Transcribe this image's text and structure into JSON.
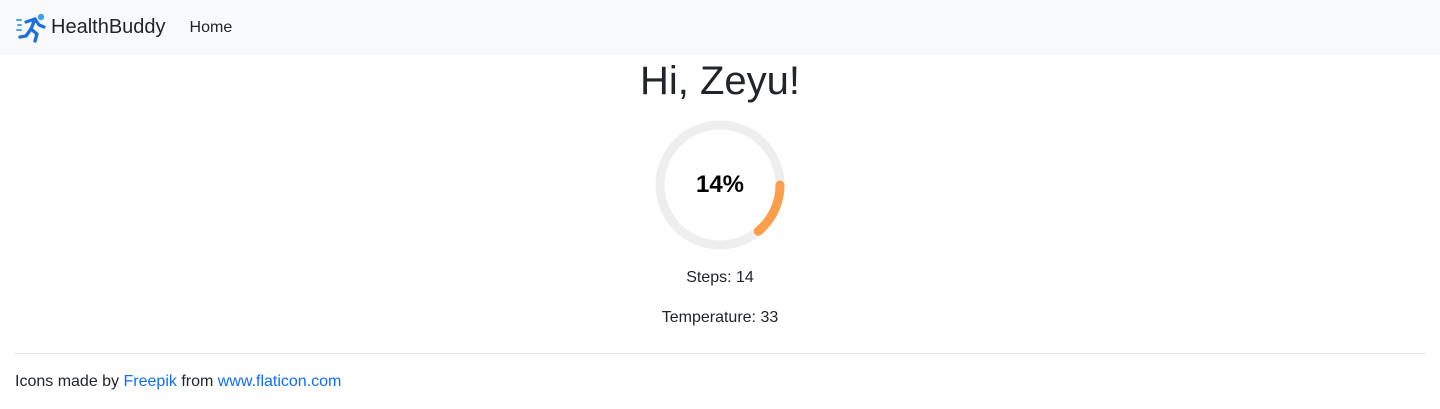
{
  "navbar": {
    "brand_name": "HealthBuddy",
    "brand_icon": "running-person-icon",
    "links": [
      "Home"
    ]
  },
  "main": {
    "greeting": "Hi, Zeyu!",
    "progress": {
      "value_percent": 14,
      "label": "14%",
      "track_color": "#eeeeee",
      "fill_color": "#fd9e4a"
    },
    "steps_text": "Steps: 14",
    "temperature_text": "Temperature: 33"
  },
  "footer": {
    "prefix": "Icons made by",
    "author_link": "Freepik",
    "middle": "from",
    "site_link": "www.flaticon.com",
    "link_color": "#0d6efd"
  }
}
